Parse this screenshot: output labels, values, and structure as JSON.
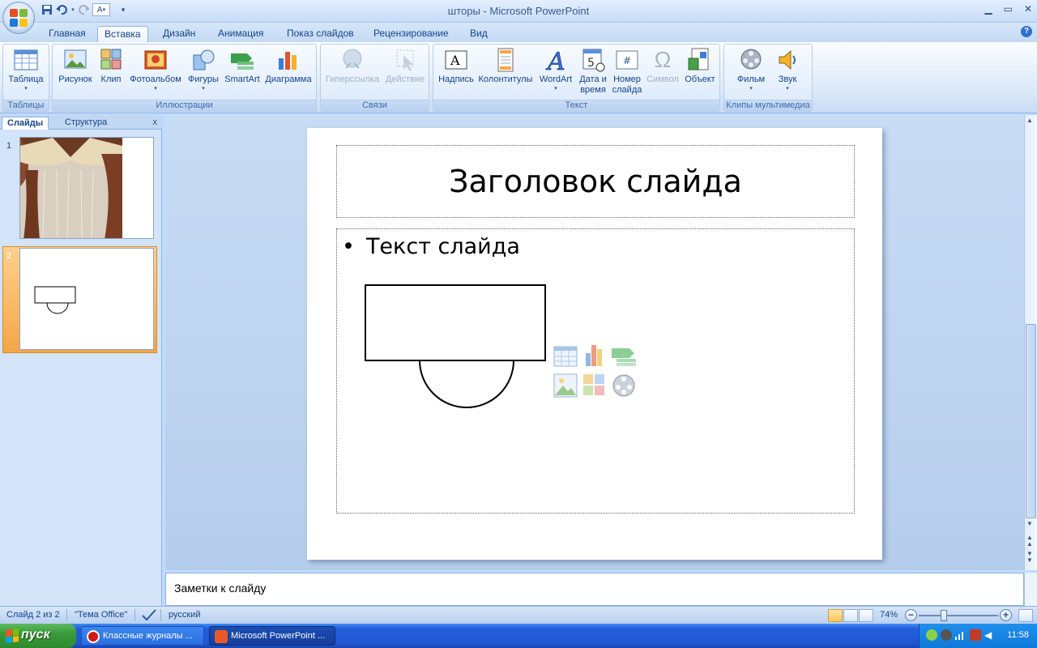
{
  "window": {
    "title": "шторы - Microsoft PowerPoint"
  },
  "qat": {
    "save_icon": "save-icon",
    "undo_icon": "undo-icon",
    "redo_icon": "redo-icon",
    "font_button_label": "A"
  },
  "tabs": [
    {
      "label": "Главная"
    },
    {
      "label": "Вставка"
    },
    {
      "label": "Дизайн"
    },
    {
      "label": "Анимация"
    },
    {
      "label": "Показ слайдов"
    },
    {
      "label": "Рецензирование"
    },
    {
      "label": "Вид"
    }
  ],
  "ribbon": {
    "groups": {
      "tables": {
        "label": "Таблицы",
        "table": "Таблица"
      },
      "illustrations": {
        "label": "Иллюстрации",
        "picture": "Рисунок",
        "clip": "Клип",
        "photoalbum": "Фотоальбом",
        "shapes": "Фигуры",
        "smartart": "SmartArt",
        "chart": "Диаграмма"
      },
      "links": {
        "label": "Связи",
        "hyperlink": "Гиперссылка",
        "action": "Действие"
      },
      "text": {
        "label": "Текст",
        "textbox": "Надпись",
        "headerfooter": "Колонтитулы",
        "wordart": "WordArt",
        "datetime_1": "Дата и",
        "datetime_2": "время",
        "slidenum_1": "Номер",
        "slidenum_2": "слайда",
        "symbol": "Символ",
        "object": "Объект"
      },
      "media": {
        "label": "Клипы мультимедиа",
        "movie": "Фильм",
        "sound": "Звук"
      }
    }
  },
  "left_pane": {
    "tab_slides": "Слайды",
    "tab_outline": "Структура",
    "close": "x",
    "slides": [
      {
        "number": "1"
      },
      {
        "number": "2"
      }
    ]
  },
  "slide": {
    "title": "Заголовок слайда",
    "bullet": "Текст слайда",
    "bullet_char": "•"
  },
  "notes": {
    "text": "Заметки к слайду"
  },
  "status": {
    "slide_info": "Слайд 2 из 2",
    "theme": "\"Тема Office\"",
    "language": "русский",
    "zoom": "74%",
    "zoom_level": 0.32
  },
  "taskbar": {
    "start": "пуск",
    "tasks": [
      {
        "label": "Классные журналы ..."
      },
      {
        "label": "Microsoft PowerPoint ..."
      }
    ],
    "clock": "11:58"
  }
}
